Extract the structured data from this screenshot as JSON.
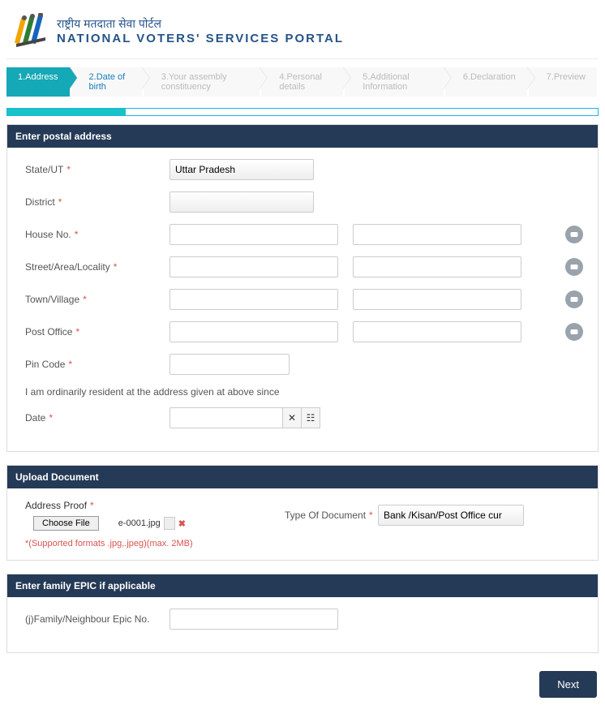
{
  "header": {
    "hindi": "राष्ट्रीय मतदाता सेवा पोर्टल",
    "eng": "NATIONAL VOTERS' SERVICES PORTAL"
  },
  "steps": [
    "1.Address",
    "2.Date of birth",
    "3.Your assembly constituency",
    "4.Personal details",
    "5.Additional Information",
    "6.Declaration",
    "7.Preview"
  ],
  "progress_percent": 20,
  "postal": {
    "title": "Enter postal address",
    "state_label": "State/UT",
    "state_value": "Uttar Pradesh",
    "district_label": "District",
    "district_value": "",
    "houseno_label": "House No.",
    "street_label": "Street/Area/Locality",
    "town_label": "Town/Village",
    "postoffice_label": "Post Office",
    "pincode_label": "Pin Code",
    "since_text": "I am ordinarily resident at the address given at above since",
    "date_label": "Date"
  },
  "upload": {
    "title": "Upload Document",
    "proof_label": "Address Proof",
    "choose_file": "Choose File",
    "file_name": "e-0001.jpg",
    "formats": "*(Supported formats .jpg,.jpeg)(max. 2MB)",
    "typedoc_label": "Type Of Document",
    "typedoc_value": "Bank /Kisan/Post Office cur"
  },
  "epic": {
    "title": "Enter family EPIC if applicable",
    "label": "(j)Family/Neighbour Epic No."
  },
  "next": "Next"
}
